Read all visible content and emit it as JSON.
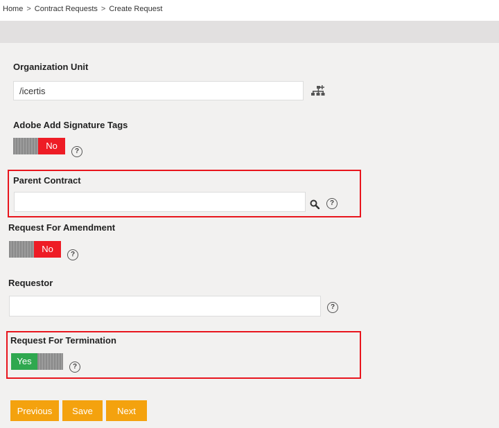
{
  "breadcrumb": {
    "items": [
      "Home",
      "Contract Requests",
      "Create Request"
    ],
    "separator": ">"
  },
  "form": {
    "organization_unit": {
      "label": "Organization Unit",
      "value": "/icertis",
      "icon": "org-tree-icon"
    },
    "adobe_signature_tags": {
      "label": "Adobe Add Signature Tags",
      "toggle_state": "No"
    },
    "parent_contract": {
      "label": "Parent Contract",
      "value": "",
      "icon": "search-icon"
    },
    "request_for_amendment": {
      "label": "Request For Amendment",
      "toggle_state": "No"
    },
    "requestor": {
      "label": "Requestor",
      "value": ""
    },
    "request_for_termination": {
      "label": "Request For Termination",
      "toggle_state": "Yes"
    },
    "help_symbol": "?"
  },
  "actions": {
    "previous_label": "Previous",
    "save_label": "Save",
    "next_label": "Next"
  },
  "colors": {
    "toggle_no": "#ee1c25",
    "toggle_yes": "#2fa84f",
    "button": "#f4a20e",
    "highlight_border": "#e8141c",
    "form_background": "#f2f1f0",
    "header_bar": "#e2e0e0"
  }
}
